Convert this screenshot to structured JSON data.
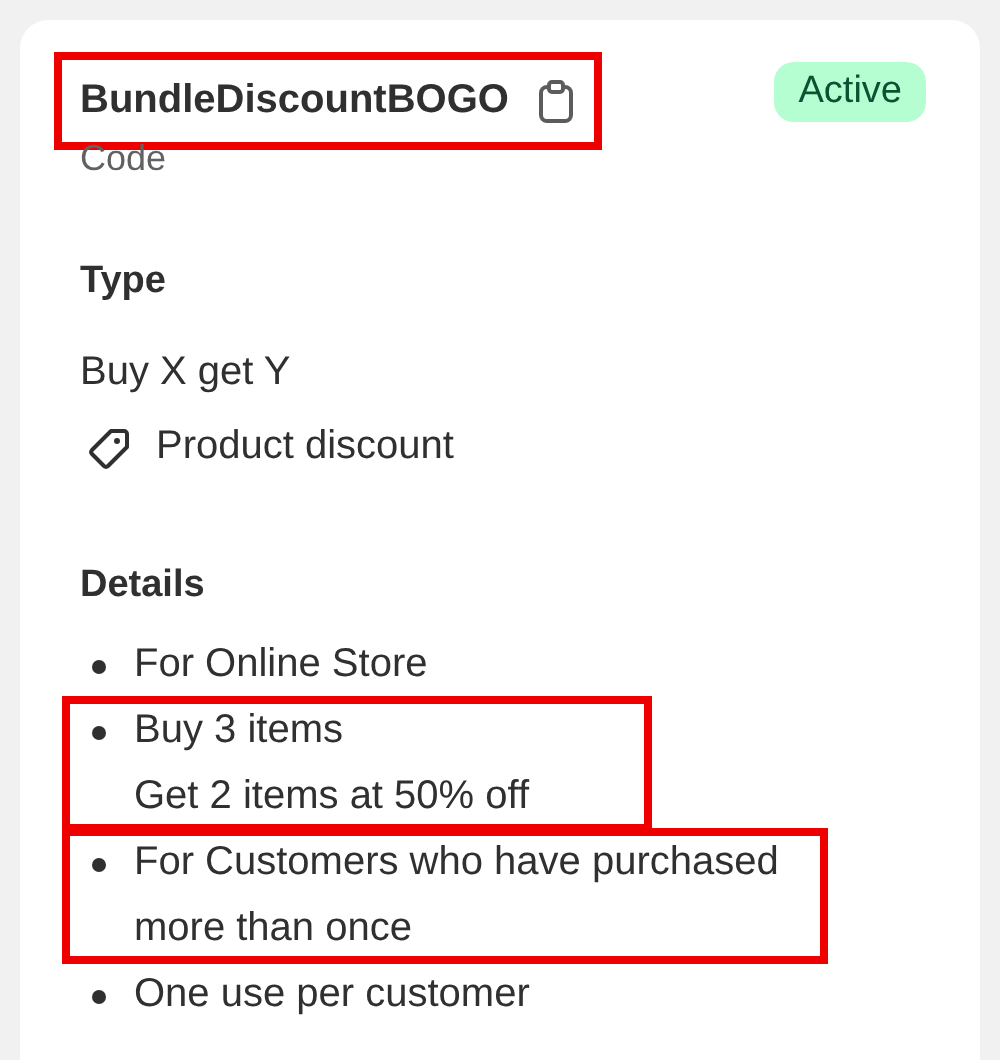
{
  "discount": {
    "code": "BundleDiscountBOGO",
    "code_highlighted": true,
    "code_label": "Code",
    "status": {
      "label": "Active",
      "kind": "success"
    }
  },
  "type_section": {
    "heading": "Type",
    "value": "Buy X get Y",
    "category": "Product discount"
  },
  "details": {
    "heading": "Details",
    "items": [
      {
        "lines": [
          "For Online Store"
        ],
        "highlighted": false
      },
      {
        "lines": [
          "Buy 3 items",
          "Get 2 items at 50% off"
        ],
        "highlighted": true
      },
      {
        "lines": [
          "For Customers who have purchased",
          "more than once"
        ],
        "highlighted": true
      },
      {
        "lines": [
          "One use per customer"
        ],
        "highlighted": false
      }
    ]
  }
}
